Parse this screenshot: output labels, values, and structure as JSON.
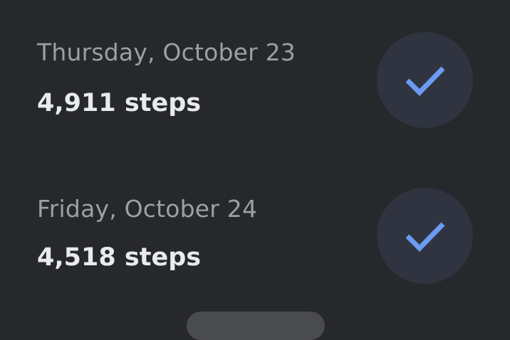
{
  "days": [
    {
      "date": "Thursday, October 23",
      "steps": "4,911 steps",
      "completed": true,
      "icon": "check-icon"
    },
    {
      "date": "Friday, October 24",
      "steps": "4,518 steps",
      "completed": true,
      "icon": "check-icon"
    }
  ],
  "colors": {
    "background": "#27282c",
    "date_text": "#9aa0a6",
    "steps_text": "#e8eaed",
    "check_circle": "#2f3440",
    "check_mark": "#6b9cf2"
  }
}
